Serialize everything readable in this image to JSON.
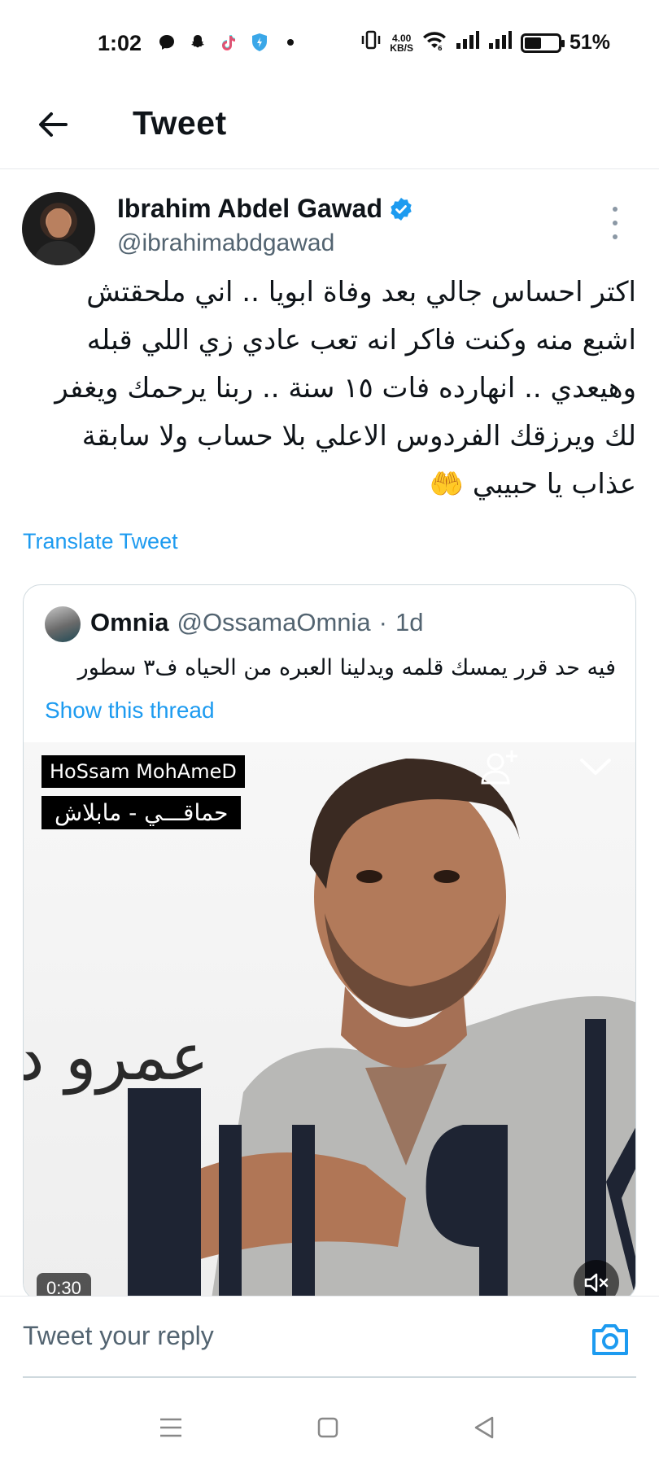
{
  "status_bar": {
    "time": "1:02",
    "net_speed_value": "4.00",
    "net_speed_unit": "KB/S",
    "battery_percent": "51%",
    "battery_level": 0.51,
    "icons": [
      "messenger-icon",
      "snapchat-icon",
      "tiktok-icon",
      "shield-icon",
      "dot-icon",
      "vibrate-icon",
      "wifi-icon",
      "signal-icon",
      "signal-icon",
      "battery-icon"
    ]
  },
  "header": {
    "title": "Tweet"
  },
  "tweet": {
    "author_name": "Ibrahim Abdel Gawad",
    "author_handle": "@ibrahimabdgawad",
    "text": "اكتر احساس جالي بعد وفاة ابويا .. اني ملحقتش اشبع منه وكنت فاكر انه تعب عادي زي اللي قبله وهيعدي .. انهارده فات ١٥ سنة .. ربنا يرحمك ويغفر لك ويرزقك الفردوس الاعلي بلا حساب ولا سابقة عذاب يا حبيبي 🤲",
    "translate_label": "Translate Tweet"
  },
  "quote": {
    "name": "Omnia",
    "handle": "@OssamaOmnia",
    "separator": "·",
    "time": "1d",
    "text": "فيه حد قرر يمسك قلمه ويدلينا العبره من الحياه ف٣ سطور",
    "show_thread_label": "Show this thread",
    "media": {
      "label_1": "HoSsam MohAmeD",
      "label_2": "حماقـــي - مابلاش",
      "brand_text": "عمرو د",
      "duration": "0:30"
    }
  },
  "reply": {
    "placeholder": "Tweet your reply"
  },
  "colors": {
    "accent": "#1d9bf0",
    "text": "#0f1419",
    "muted": "#536471",
    "border": "#cfd9de"
  }
}
